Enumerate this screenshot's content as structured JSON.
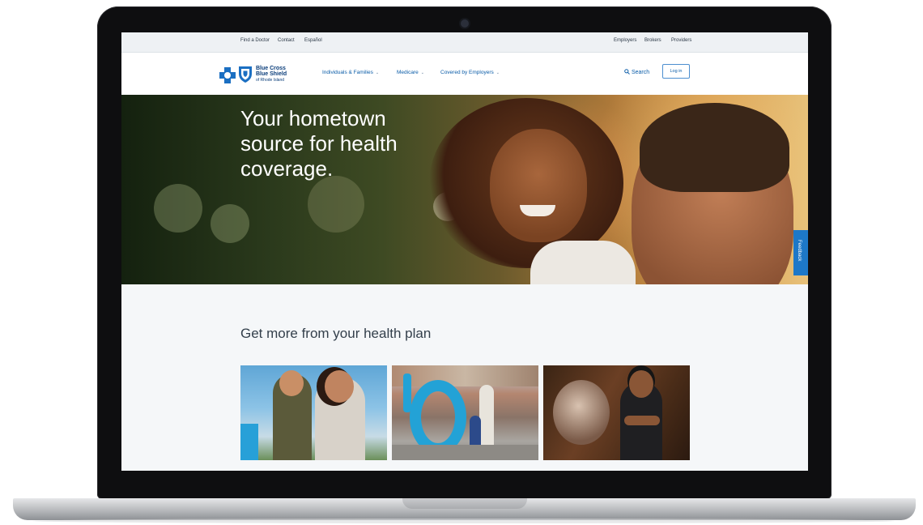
{
  "utility_nav": {
    "left": [
      "Find a Doctor",
      "Contact",
      "Español"
    ],
    "right": [
      "Employers",
      "Brokers",
      "Providers"
    ]
  },
  "logo": {
    "line1": "Blue Cross",
    "line2": "Blue Shield",
    "line3": "of Rhode Island"
  },
  "main_nav": {
    "items": [
      "Individuals & Families",
      "Medicare",
      "Covered by Employers"
    ],
    "search_label": "Search",
    "login_label": "Log in"
  },
  "hero": {
    "headline": "Your hometown source for health coverage."
  },
  "feedback_label": "Feedback",
  "section": {
    "title": "Get more from your health plan"
  },
  "colors": {
    "brand_blue": "#0a3d7a",
    "link_blue": "#0a5ca8",
    "feedback_blue": "#1d78c8"
  },
  "icons": {
    "search": "magnifier-icon",
    "chevron": "chevron-down-icon"
  }
}
